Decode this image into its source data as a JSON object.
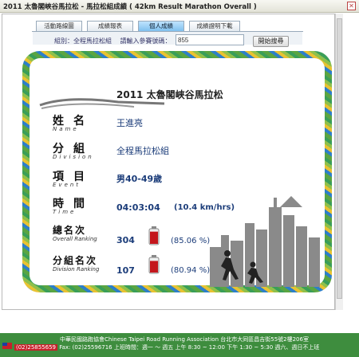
{
  "window": {
    "title": "2011 太魯閣峽谷馬拉松 - 馬拉松組成績 ( 42km Result Marathon Overall )"
  },
  "tabs": [
    {
      "label": "活動路線圖"
    },
    {
      "label": "成績報表"
    },
    {
      "label": "個人成績"
    },
    {
      "label": "成績證明下載"
    }
  ],
  "search": {
    "group_label": "組別：全程馬拉松組",
    "id_label": "請輸入參賽號碼：",
    "id_value": "855",
    "button": "開始搜尋"
  },
  "certificate": {
    "title": "2011 太魯閣峽谷馬拉松",
    "name": {
      "label": "姓名",
      "sub": "Name",
      "value": "王進亮"
    },
    "division": {
      "label": "分組",
      "sub": "Division",
      "value": "全程馬拉松組"
    },
    "event": {
      "label": "項目",
      "sub": "Event",
      "value": "男40-49歲"
    },
    "time": {
      "label": "時間",
      "sub": "Time",
      "value": "04:03:04",
      "speed": "(10.4 km/hrs)"
    },
    "overall": {
      "label": "總名次",
      "sub": "Overall Ranking",
      "value": "304",
      "pct": "(85.06 %)",
      "fill": 0.8506
    },
    "div_rank": {
      "label": "分組名次",
      "sub": "Division Ranking",
      "value": "107",
      "pct": "(80.94 %)",
      "fill": 0.8094
    }
  },
  "footer": {
    "line1": "中華民國路跑協會Chinese Taipei Road Running Association   台北市大同區昌吉街55號2樓206室",
    "phone": "(02)25855659",
    "line2": "Fax: (02)25596716   上班時間：週一 ～ 週五  上午 8:30 ~ 12:00   下午 1:30 ~ 5:30   週六、週日不上班"
  }
}
